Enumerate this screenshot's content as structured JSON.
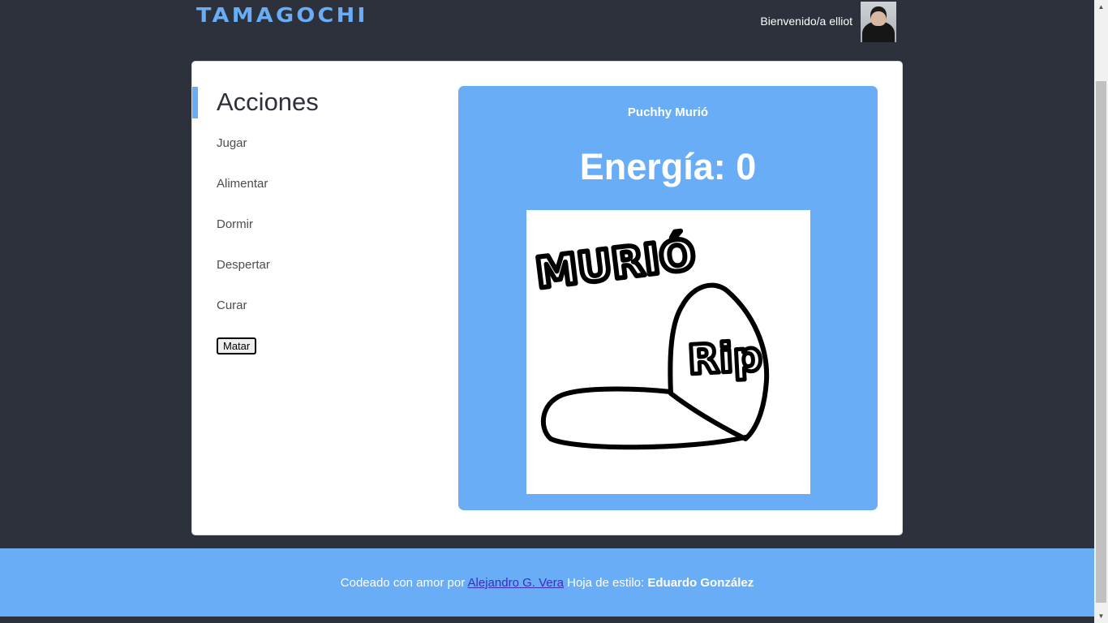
{
  "header": {
    "logo": "TAMAGOCHI",
    "welcome": "Bienvenido/a elliot"
  },
  "sidebar": {
    "title": "Acciones",
    "actions": [
      "Jugar",
      "Alimentar",
      "Dormir",
      "Despertar",
      "Curar"
    ],
    "kill_button": "Matar"
  },
  "pet": {
    "status": "Puchhy Murió",
    "energy_label": "Energía:",
    "energy_value": "0",
    "image_text_top": "MURIÓ",
    "image_text_grave": "Rip"
  },
  "footer": {
    "prefix": "Codeado con amor por",
    "author": "Alejandro G. Vera",
    "stylesheet_label": "Hoja de estilo:",
    "stylesheet_author": "Eduardo González"
  },
  "colors": {
    "background": "#2c313c",
    "accent": "#6aadf7",
    "card": "#ffffff"
  },
  "icons": {
    "scroll_up": "chevron-up-icon",
    "scroll_down": "chevron-down-icon"
  }
}
